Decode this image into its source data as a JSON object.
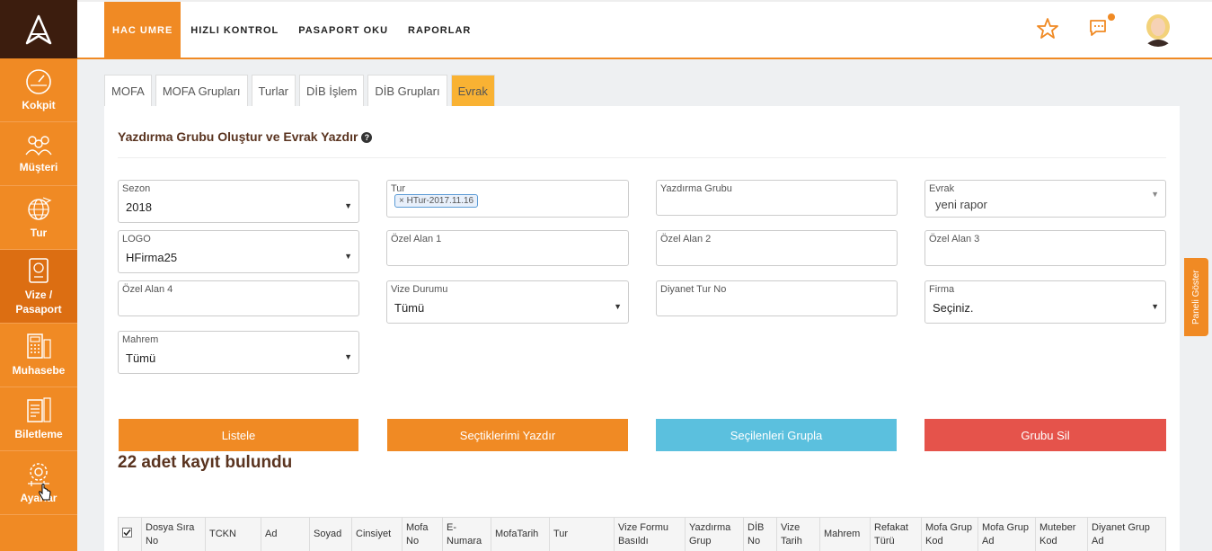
{
  "sidebar": {
    "logo_icon": "app-logo-icon",
    "items": [
      {
        "label": "Kokpit",
        "icon": "gauge-icon"
      },
      {
        "label": "Müşteri",
        "icon": "people-icon"
      },
      {
        "label": "Tur",
        "icon": "globe-icon"
      },
      {
        "label": "Vize / Pasaport",
        "icon": "passport-icon"
      },
      {
        "label": "Muhasebe",
        "icon": "calculator-icon"
      },
      {
        "label": "Biletleme",
        "icon": "ticket-icon"
      },
      {
        "label": "Ayarlar",
        "icon": "settings-icon"
      }
    ]
  },
  "topnav": {
    "items": [
      {
        "label": "HAC UMRE"
      },
      {
        "label": "HIZLI KONTROL"
      },
      {
        "label": "PASAPORT OKU"
      },
      {
        "label": "RAPORLAR"
      }
    ]
  },
  "tabs": [
    {
      "label": "MOFA"
    },
    {
      "label": "MOFA Grupları"
    },
    {
      "label": "Turlar"
    },
    {
      "label": "DİB İşlem"
    },
    {
      "label": "DİB Grupları"
    },
    {
      "label": "Evrak"
    }
  ],
  "panel": {
    "title": "Yazdırma Grubu Oluştur ve Evrak Yazdır",
    "fields": {
      "sezon": {
        "label": "Sezon",
        "value": "2018"
      },
      "tur": {
        "label": "Tur",
        "chip": "HTur-2017.11.16"
      },
      "yazdirma_grubu": {
        "label": "Yazdırma Grubu",
        "value": ""
      },
      "evrak": {
        "label": "Evrak",
        "value": "yeni rapor"
      },
      "logo": {
        "label": "LOGO",
        "value": "HFirma25"
      },
      "ozel1": {
        "label": "Özel Alan 1",
        "value": ""
      },
      "ozel2": {
        "label": "Özel Alan 2",
        "value": ""
      },
      "ozel3": {
        "label": "Özel Alan 3",
        "value": ""
      },
      "ozel4": {
        "label": "Özel Alan 4",
        "value": ""
      },
      "vize_durumu": {
        "label": "Vize Durumu",
        "value": "Tümü"
      },
      "diyanet_tur_no": {
        "label": "Diyanet Tur No",
        "value": ""
      },
      "firma": {
        "label": "Firma",
        "value": "Seçiniz."
      },
      "mahrem": {
        "label": "Mahrem",
        "value": "Tümü"
      }
    },
    "buttons": {
      "listele": "Listele",
      "yazdir": "Seçtiklerimi Yazdır",
      "grupla": "Seçilenleri Grupla",
      "sil": "Grubu Sil"
    },
    "result_text": "22 adet kayıt bulundu",
    "table_headers": [
      "Dosya Sıra No",
      "TCKN",
      "Ad",
      "Soyad",
      "Cinsiyet",
      "Mofa No",
      "E-Numara",
      "MofaTarih",
      "Tur",
      "Vize Formu Basıldı",
      "Yazdırma Grup",
      "DİB No",
      "Vize Tarih",
      "Mahrem",
      "Refakat Türü",
      "Mofa Grup Kod",
      "Mofa Grup Ad",
      "Muteber Kod",
      "Diyanet Grup Ad"
    ]
  },
  "side_toggle": "Paneli Göster",
  "colors": {
    "accent": "#f08a24",
    "accent_dark": "#dc6e12",
    "logo_bg": "#3c1d0e",
    "tab_active": "#f9b233",
    "btn_blue": "#5bc0de",
    "btn_red": "#e5534b"
  }
}
